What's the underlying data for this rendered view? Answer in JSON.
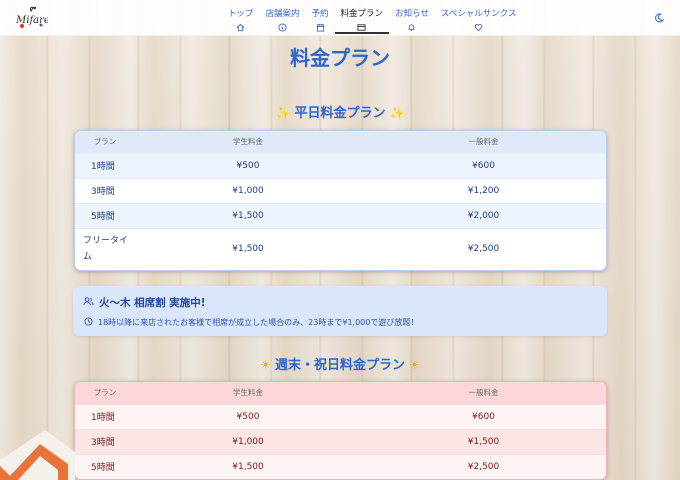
{
  "header": {
    "logo_text": "Mifare",
    "nav": [
      {
        "label": "トップ",
        "icon": "home-icon"
      },
      {
        "label": "店舗案内",
        "icon": "info-icon"
      },
      {
        "label": "予約",
        "icon": "calendar-icon"
      },
      {
        "label": "料金プラン",
        "icon": "card-icon",
        "active": true
      },
      {
        "label": "お知らせ",
        "icon": "bell-icon"
      },
      {
        "label": "スペシャルサンクス",
        "icon": "heart-icon"
      }
    ],
    "theme_icon": "moon-icon"
  },
  "page_title": "料金プラン",
  "weekday": {
    "title": "平日料金プラン",
    "headers": {
      "plan": "プラン",
      "student": "学生料金",
      "general": "一般料金"
    },
    "rows": [
      {
        "plan": "1時間",
        "student": "¥500",
        "general": "¥600"
      },
      {
        "plan": "3時間",
        "student": "¥1,000",
        "general": "¥1,200"
      },
      {
        "plan": "5時間",
        "student": "¥1,500",
        "general": "¥2,000"
      },
      {
        "plan": "フリータイム",
        "student": "¥1,500",
        "general": "¥2,500"
      }
    ]
  },
  "promo": {
    "title": "火〜木 相席割 実施中!",
    "desc": "18時以降に来店されたお客様で相席が成立した場合のみ、23時まで¥1,000で遊び放題！"
  },
  "weekend": {
    "title": "週末・祝日料金プラン",
    "headers": {
      "plan": "プラン",
      "student": "学生料金",
      "general": "一般料金"
    },
    "rows": [
      {
        "plan": "1時間",
        "student": "¥500",
        "general": "¥600"
      },
      {
        "plan": "3時間",
        "student": "¥1,000",
        "general": "¥1,500"
      },
      {
        "plan": "5時間",
        "student": "¥1,500",
        "general": "¥2,500"
      }
    ]
  },
  "colors": {
    "accent": "#2d66cc",
    "weekday_head": "#dfe9fa",
    "weekend_head": "#fbd7d7"
  }
}
